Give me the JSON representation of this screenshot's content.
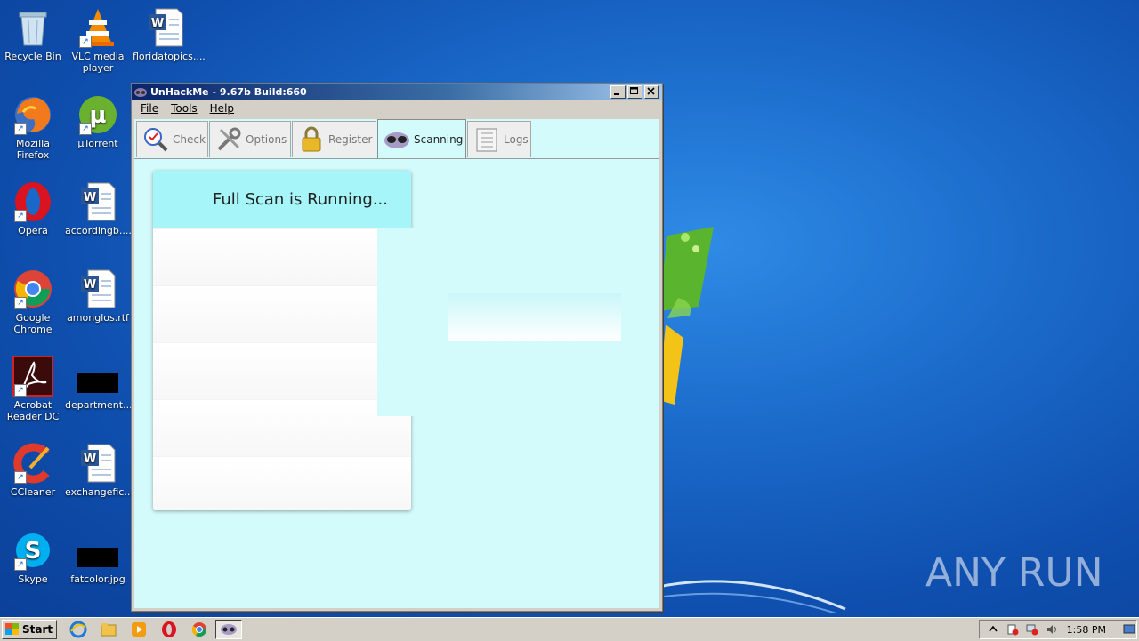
{
  "desktop": {
    "icons": [
      {
        "label": "Recycle Bin",
        "icon": "recycle-bin-icon"
      },
      {
        "label": "VLC media player",
        "icon": "vlc-icon"
      },
      {
        "label": "floridatopics....",
        "icon": "word-doc-icon"
      },
      {
        "label": "Mozilla Firefox",
        "icon": "firefox-icon"
      },
      {
        "label": "µTorrent",
        "icon": "utorrent-icon"
      },
      {
        "label": "Opera",
        "icon": "opera-icon"
      },
      {
        "label": "accordingb....",
        "icon": "word-doc-icon"
      },
      {
        "label": "Google Chrome",
        "icon": "chrome-icon"
      },
      {
        "label": "amonglos.rtf",
        "icon": "word-doc-icon"
      },
      {
        "label": "Acrobat Reader DC",
        "icon": "acrobat-icon"
      },
      {
        "label": "department....",
        "icon": "black-thumbnail-icon"
      },
      {
        "label": "CCleaner",
        "icon": "ccleaner-icon"
      },
      {
        "label": "exchangefic....",
        "icon": "word-doc-icon"
      },
      {
        "label": "Skype",
        "icon": "skype-icon"
      },
      {
        "label": "fatcolor.jpg",
        "icon": "black-thumbnail-icon"
      }
    ]
  },
  "window": {
    "title": "UnHackMe - 9.67b Build:660",
    "menu": [
      "File",
      "Tools",
      "Help"
    ],
    "tabs": [
      {
        "label": "Check",
        "icon": "magnifier-check-icon"
      },
      {
        "label": "Options",
        "icon": "tools-icon"
      },
      {
        "label": "Register",
        "icon": "padlock-icon"
      },
      {
        "label": "Scanning",
        "icon": "glasses-icon",
        "active": true
      },
      {
        "label": "Logs",
        "icon": "log-sheet-icon"
      }
    ],
    "scan_status": "Full Scan is Running..."
  },
  "taskbar": {
    "start_label": "Start",
    "clock": "1:58 PM"
  },
  "watermark": "ANY RUN",
  "colors": {
    "panel_bg": "#d4fbfb",
    "scan_header_bg": "#a6f5f9",
    "desktop_blue": "#1a69c9"
  }
}
